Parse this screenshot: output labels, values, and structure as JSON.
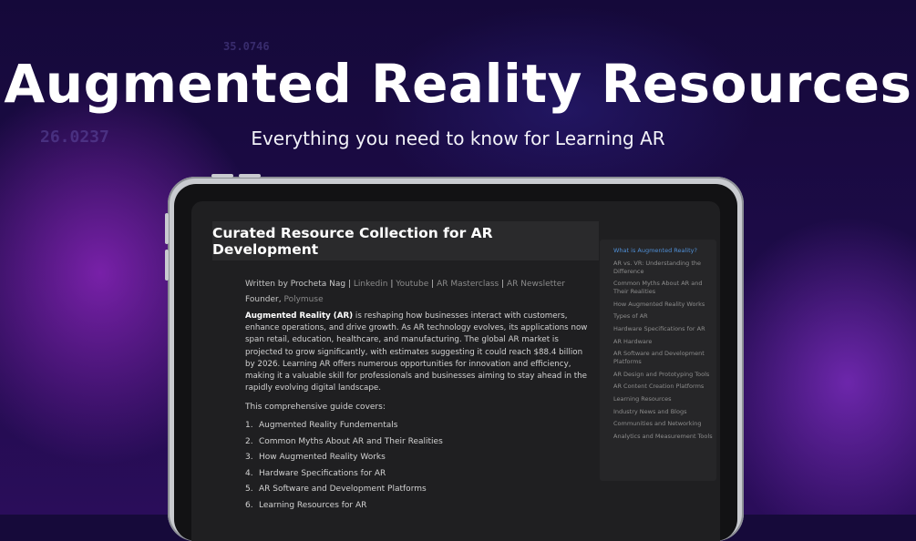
{
  "banner": {
    "title": "Augmented Reality Resources",
    "subtitle": "Everything you need to know for Learning AR",
    "bg_numbers": [
      "35.0746",
      "26.0237"
    ]
  },
  "document": {
    "heading": "Curated Resource Collection for AR Development",
    "byline": {
      "prefix": "Written by Procheta Nag",
      "links": [
        "Linkedin",
        "Youtube",
        "AR Masterclass",
        "AR Newsletter"
      ],
      "separator": "|"
    },
    "role": {
      "prefix": "Founder,",
      "org": "Polymuse"
    },
    "intro_bold": "Augmented Reality (AR)",
    "intro_rest": " is reshaping how businesses interact with customers, enhance operations, and drive growth. As AR technology evolves, its applications now span retail, education, healthcare, and manufacturing. The global AR market is projected to grow significantly, with estimates suggesting it could reach $88.4 billion by 2026. Learning AR offers numerous opportunities for innovation and efficiency, making it a valuable skill for professionals and businesses aiming to stay ahead in the rapidly evolving digital landscape.",
    "covers_label": "This comprehensive guide covers:",
    "guide_items": [
      {
        "num": "1.",
        "text": "Augmented Reality Fundementals"
      },
      {
        "num": "2.",
        "text": "Common Myths About AR and Their Realities"
      },
      {
        "num": "3.",
        "text": "How Augmented Reality Works"
      },
      {
        "num": "4.",
        "text": "Hardware Specifications for AR"
      },
      {
        "num": "5.",
        "text": "AR Software and Development Platforms"
      },
      {
        "num": "6.",
        "text": "Learning Resources for AR"
      }
    ]
  },
  "toc": {
    "items": [
      "What is Augmented Reality?",
      "AR vs. VR: Understanding the Difference",
      "Common Myths About AR and Their Realities",
      "How Augmented Reality Works",
      "Types of AR",
      "Hardware Specifications for AR",
      "AR Hardware",
      "AR Software and Development Platforms",
      "AR Design and Prototyping Tools",
      "AR Content Creation Platforms",
      "Learning Resources",
      "Industry News and Blogs",
      "Communities and Networking",
      "Analytics and Measurement Tools"
    ],
    "active_index": 0
  },
  "colors": {
    "accent_link": "#4f8fd6",
    "background": "#160a3a",
    "purple_glow": "#9628c8"
  }
}
